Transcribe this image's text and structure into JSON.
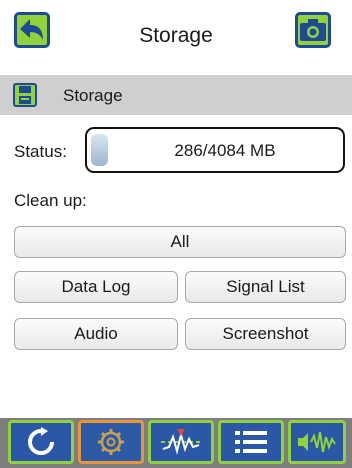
{
  "header": {
    "title": "Storage",
    "back_icon": "back-arrow-icon",
    "camera_icon": "camera-icon"
  },
  "section": {
    "label": "Storage",
    "icon": "save-disk-icon"
  },
  "status": {
    "label": "Status:",
    "value": "286/4084 MB",
    "used_fraction": 0.07
  },
  "cleanup": {
    "label": "Clean up:",
    "buttons": {
      "all": "All",
      "data_log": "Data Log",
      "signal_list": "Signal List",
      "audio": "Audio",
      "screenshot": "Screenshot"
    }
  },
  "toolbar": {
    "items": [
      {
        "icon": "refresh-icon",
        "active": false
      },
      {
        "icon": "gear-icon",
        "active": true
      },
      {
        "icon": "waveform-icon",
        "active": false
      },
      {
        "icon": "list-icon",
        "active": false
      },
      {
        "icon": "audio-signal-icon",
        "active": false
      }
    ]
  },
  "colors": {
    "accent_green": "#8fd23b",
    "tool_blue": "#2a58a7",
    "active_orange": "#e8963a",
    "section_gray": "#cfcfcf",
    "toolbar_gray": "#7e7e7e"
  }
}
